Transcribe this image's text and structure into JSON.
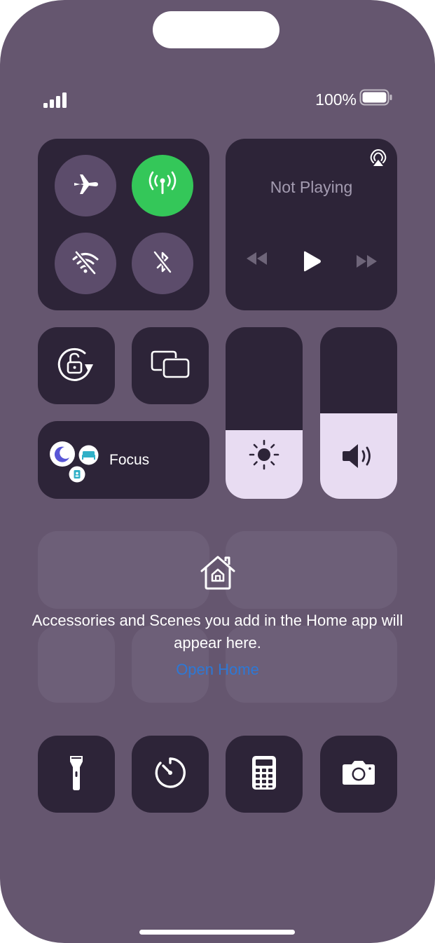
{
  "status_bar": {
    "battery_percent": "100%",
    "signal_icon": "cellular-signal-icon",
    "battery_icon": "battery-full-icon"
  },
  "connectivity": {
    "airplane_icon": "airplane-icon",
    "cellular_icon": "cellular-antenna-icon",
    "wifi_icon": "wifi-off-icon",
    "bluetooth_icon": "bluetooth-off-icon",
    "active_color": "#34c759"
  },
  "media": {
    "title": "Not Playing",
    "airplay_icon": "airplay-icon",
    "controls": [
      "rewind-icon",
      "play-icon",
      "fast-forward-icon"
    ]
  },
  "controls": {
    "rotation_lock_icon": "rotation-lock-icon",
    "screen_mirroring_icon": "screen-mirroring-icon",
    "focus_label": "Focus"
  },
  "sliders": {
    "brightness_level": 0.4,
    "volume_level": 0.5
  },
  "home": {
    "message": "Accessories and Scenes you add in the Home app will appear here.",
    "link": "Open Home",
    "link_color": "#2d78d6"
  },
  "bottom_row": [
    "flashlight-icon",
    "timer-icon",
    "calculator-icon",
    "camera-icon"
  ]
}
